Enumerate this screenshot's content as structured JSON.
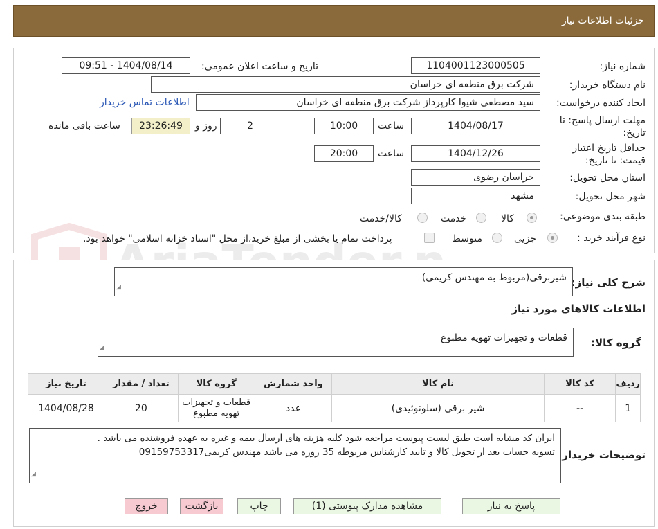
{
  "header": {
    "title": "جزئیات اطلاعات نیاز"
  },
  "watermark": {
    "text": "AriaTender.neT"
  },
  "form": {
    "need_number_label": "شماره نیاز:",
    "need_number": "1104001123000505",
    "announce_label": "تاریخ و ساعت اعلان عمومی:",
    "announce_value": "1404/08/14 - 09:51",
    "buyer_org_label": "نام دستگاه خریدار:",
    "buyer_org": "شرکت برق منطقه ای خراسان",
    "creator_label": "ایجاد کننده درخواست:",
    "creator": "سید مصطفی شیوا کارپرداز شرکت برق منطقه ای خراسان",
    "contact_link": "اطلاعات تماس خریدار",
    "deadline_label_1": "مهلت ارسال پاسخ: تا",
    "deadline_label_2": "تاریخ:",
    "deadline_date": "1404/08/17",
    "time_label": "ساعت",
    "deadline_time": "10:00",
    "days_value": "2",
    "days_label": "روز و",
    "remaining_time": "23:26:49",
    "remaining_label": "ساعت باقی مانده",
    "validity_label_1": "حداقل تاریخ اعتبار",
    "validity_label_2": "قیمت: تا تاریخ:",
    "validity_date": "1404/12/26",
    "validity_time": "20:00",
    "province_label": "استان محل تحویل:",
    "province": "خراسان رضوی",
    "city_label": "شهر محل تحویل:",
    "city": "مشهد",
    "category_label": "طبقه بندی موضوعی:",
    "category_options": [
      "کالا",
      "خدمت",
      "کالا/خدمت"
    ],
    "category_selected": "کالا",
    "process_label": "نوع فرآیند خرید :",
    "process_options": [
      "جزیی",
      "متوسط"
    ],
    "process_selected": "جزیی",
    "payment_note": "پرداخت تمام یا بخشی از مبلغ خرید،از محل \"اسناد خزانه اسلامی\" خواهد بود."
  },
  "details": {
    "desc_label": "شرح کلی نیاز:",
    "desc": "شیربرقی(مربوط به مهندس کریمی)",
    "goods_info_title": "اطلاعات کالاهای مورد نیاز",
    "group_label": "گروه کالا:",
    "group": "قطعات و تجهیزات تهویه مطبوع",
    "table": {
      "headers": [
        "ردیف",
        "کد کالا",
        "نام کالا",
        "واحد شمارش",
        "گروه کالا",
        "تعداد / مقدار",
        "تاریخ نیاز"
      ],
      "rows": [
        [
          "1",
          "--",
          "شیر برقی (سلونوئیدی)",
          "عدد",
          "قطعات و تجهیزات تهویه مطبوع",
          "20",
          "1404/08/28"
        ]
      ]
    },
    "buyer_notes_label": "توضیحات خریدار:",
    "buyer_notes_line1": "ایران کد مشابه است طبق لیست پیوست مراجعه شود کلیه هزینه های ارسال بیمه و غیره به عهده فروشنده می باشد .",
    "buyer_notes_line2": "تسویه حساب بعد از تحویل کالا و تایید کارشناس مربوطه 35 روزه می باشد مهندس کریمی09159753317"
  },
  "buttons": {
    "reply": "پاسخ به نیاز",
    "attachments": "مشاهده مدارک پیوستی (1)",
    "print": "چاپ",
    "back": "بازگشت",
    "exit": "خروج"
  },
  "colors": {
    "header_bg": "#8a6a3a",
    "link": "#2a57b5",
    "timer_bg": "#f3f0c9",
    "btn_green": "#eaf7e3",
    "btn_red": "#f7c9d1"
  }
}
